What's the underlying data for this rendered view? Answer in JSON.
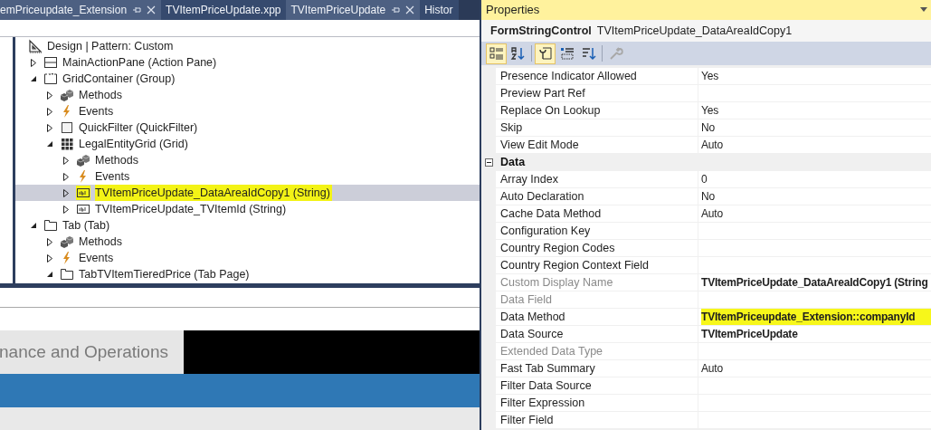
{
  "editor_tabs": [
    {
      "label": "emPriceupdate_Extension",
      "pinned": true
    },
    {
      "label": "TVItemPriceUpdate.xpp",
      "pinned": false
    },
    {
      "label": "TVItemPriceUpdate",
      "pinned": true
    },
    {
      "label": "Histor",
      "pinned": false
    }
  ],
  "tree": [
    {
      "label": "Design | Pattern: Custom",
      "kind": "design",
      "selected": false,
      "highlighted": false,
      "children": [
        {
          "label": "MainActionPane (Action Pane)",
          "kind": "actionpane",
          "expanded": false,
          "selected": false,
          "highlighted": false
        },
        {
          "label": "GridContainer (Group)",
          "kind": "group",
          "expanded": true,
          "selected": false,
          "highlighted": false,
          "children": [
            {
              "label": "Methods",
              "kind": "methods",
              "expanded": false,
              "selected": false,
              "highlighted": false
            },
            {
              "label": "Events",
              "kind": "events",
              "expanded": false,
              "selected": false,
              "highlighted": false
            },
            {
              "label": "QuickFilter (QuickFilter)",
              "kind": "quickfilter",
              "expanded": false,
              "selected": false,
              "highlighted": false
            },
            {
              "label": "LegalEntityGrid (Grid)",
              "kind": "grid",
              "expanded": true,
              "selected": false,
              "highlighted": false,
              "children": [
                {
                  "label": "Methods",
                  "kind": "methods",
                  "expanded": false,
                  "selected": false,
                  "highlighted": false
                },
                {
                  "label": "Events",
                  "kind": "events",
                  "expanded": false,
                  "selected": false,
                  "highlighted": false
                },
                {
                  "label": "TVItemPriceUpdate_DataAreaIdCopy1 (String)",
                  "kind": "string",
                  "expanded": false,
                  "selected": true,
                  "highlighted": true
                },
                {
                  "label": "TVItemPriceUpdate_TVItemId (String)",
                  "kind": "string",
                  "expanded": false,
                  "selected": false,
                  "highlighted": false
                }
              ]
            }
          ]
        },
        {
          "label": "Tab (Tab)",
          "kind": "tab",
          "expanded": true,
          "selected": false,
          "highlighted": false,
          "children": [
            {
              "label": "Methods",
              "kind": "methods",
              "expanded": false,
              "selected": false,
              "highlighted": false
            },
            {
              "label": "Events",
              "kind": "events",
              "expanded": false,
              "selected": false,
              "highlighted": false
            },
            {
              "label": "TabTVItemTieredPrice (Tab Page)",
              "kind": "tab",
              "expanded": true,
              "selected": false,
              "highlighted": false
            }
          ]
        }
      ]
    }
  ],
  "app_header": {
    "title": "nance and Operations"
  },
  "properties": {
    "title": "Properties",
    "object_type": "FormStringControl",
    "object_name": "TVItemPriceUpdate_DataAreaIdCopy1",
    "toolbar": [
      {
        "kind": "categorized",
        "selected": true
      },
      {
        "kind": "alphabetical",
        "selected": false
      },
      {
        "kind": "properties",
        "selected": true
      },
      {
        "kind": "events",
        "selected": false
      },
      {
        "kind": "sort",
        "selected": false
      },
      {
        "kind": "wrench",
        "selected": false
      }
    ],
    "rows": [
      {
        "kind": "property",
        "label": "Presence Indicator Allowed",
        "value": "Yes",
        "disabled": false,
        "bold": false,
        "highlighted": false
      },
      {
        "kind": "property",
        "label": "Preview Part Ref",
        "disabled": false
      },
      {
        "kind": "property",
        "label": "Replace On Lookup",
        "value": "Yes",
        "disabled": false,
        "bold": false,
        "highlighted": false
      },
      {
        "kind": "property",
        "label": "Skip",
        "value": "No",
        "disabled": false,
        "bold": false,
        "highlighted": false
      },
      {
        "kind": "property",
        "label": "View Edit Mode",
        "value": "Auto",
        "disabled": false,
        "bold": false,
        "highlighted": false
      },
      {
        "kind": "category",
        "label": "Data",
        "expanded": true
      },
      {
        "kind": "property",
        "label": "Array Index",
        "value": "0",
        "disabled": false,
        "bold": false,
        "highlighted": false
      },
      {
        "kind": "property",
        "label": "Auto Declaration",
        "value": "No",
        "disabled": false,
        "bold": false,
        "highlighted": false
      },
      {
        "kind": "property",
        "label": "Cache Data Method",
        "value": "Auto",
        "disabled": false,
        "bold": false,
        "highlighted": false
      },
      {
        "kind": "property",
        "label": "Configuration Key",
        "disabled": false
      },
      {
        "kind": "property",
        "label": "Country Region Codes",
        "disabled": false
      },
      {
        "kind": "property",
        "label": "Country Region Context Field",
        "disabled": false
      },
      {
        "kind": "property",
        "label": "Custom Display Name",
        "value": "TVItemPriceUpdate_DataAreaIdCopy1 (String",
        "disabled": true,
        "bold": true,
        "highlighted": false
      },
      {
        "kind": "property",
        "label": "Data Field",
        "disabled": true
      },
      {
        "kind": "property",
        "label": "Data Method",
        "value": "TVItemPriceupdate_Extension::companyId",
        "disabled": false,
        "bold": true,
        "highlighted": true
      },
      {
        "kind": "property",
        "label": "Data Source",
        "value": "TVItemPriceUpdate",
        "disabled": false,
        "bold": true,
        "highlighted": false
      },
      {
        "kind": "property",
        "label": "Extended Data Type",
        "disabled": true
      },
      {
        "kind": "property",
        "label": "Fast Tab Summary",
        "value": "Auto",
        "disabled": false,
        "bold": false,
        "highlighted": false
      },
      {
        "kind": "property",
        "label": "Filter Data Source",
        "disabled": false
      },
      {
        "kind": "property",
        "label": "Filter Expression",
        "disabled": false
      },
      {
        "kind": "property",
        "label": "Filter Field",
        "disabled": false
      }
    ]
  }
}
